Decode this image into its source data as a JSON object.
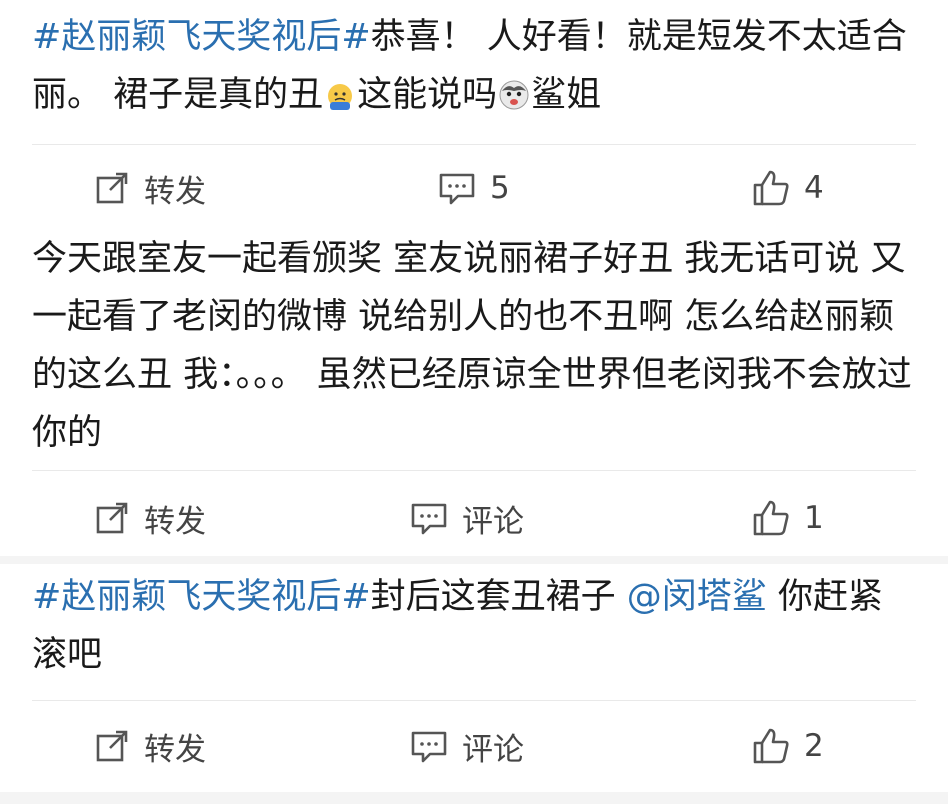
{
  "posts": [
    {
      "hashtag": "#赵丽颖飞天奖视后#",
      "text_a": "恭喜！ 人好看！就是短发不太适合丽。 裙子是真的丑",
      "text_b": "这能说吗",
      "text_c": "鲨姐",
      "emoji_a": "sweat-emoji-icon",
      "emoji_b": "husky-emoji-icon",
      "repost_label": "转发",
      "comment_label": "5",
      "like_label": "4"
    },
    {
      "text": "今天跟室友一起看颁奖 室友说丽裙子好丑 我无话可说 又一起看了老闵的微博 说给别人的也不丑啊 怎么给赵丽颖的这么丑 我：。。。 虽然已经原谅全世界但老闵我不会放过你的",
      "repost_label": "转发",
      "comment_label": "评论",
      "like_label": "1"
    },
    {
      "hashtag": "#赵丽颖飞天奖视后#",
      "text_a": "封后这套丑裙子 ",
      "mention": "@闵塔鲨",
      "text_b": " 你赶紧滚吧",
      "repost_label": "转发",
      "comment_label": "评论",
      "like_label": "2"
    }
  ],
  "colors": {
    "link": "#2a6fb0",
    "text": "#1a1a1a",
    "icon": "#555555"
  }
}
